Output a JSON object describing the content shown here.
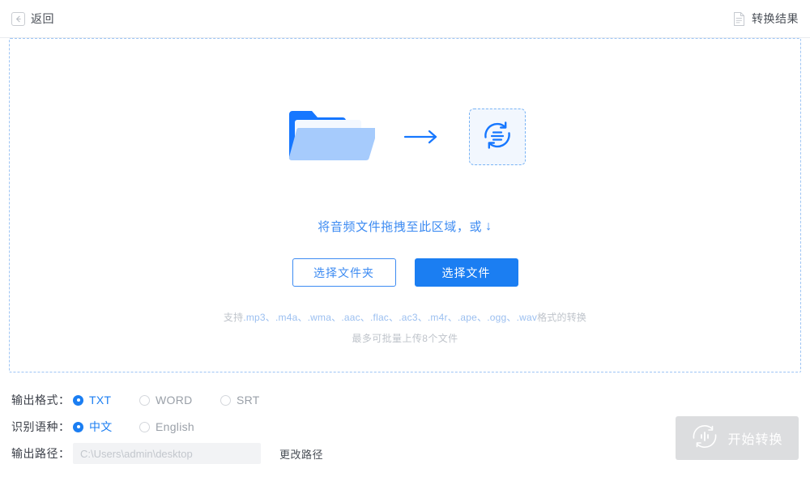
{
  "header": {
    "back_label": "返回",
    "back_icon": "arrow-left-icon",
    "result_label": "转换结果",
    "result_icon": "document-icon"
  },
  "dropzone": {
    "folder_icon": "folder-icon",
    "arrow_icon": "arrow-right-icon",
    "target_icon": "audio-convert-icon",
    "drag_text": "将音频文件拖拽至此区域，或",
    "drag_arrow": "↓",
    "select_folder_label": "选择文件夹",
    "select_file_label": "选择文件",
    "formats_prefix": "支持",
    "formats_text": ".mp3、.m4a、.wma、.aac、.flac、.ac3、.m4r、.ape、.ogg、.wav",
    "formats_suffix": "格式的转换",
    "limit_text": "最多可批量上传8个文件"
  },
  "settings": {
    "output_format_label": "输出格式：",
    "output_format_options": [
      {
        "label": "TXT",
        "checked": true
      },
      {
        "label": "WORD",
        "checked": false
      },
      {
        "label": "SRT",
        "checked": false
      }
    ],
    "language_label": "识别语种：",
    "language_options": [
      {
        "label": "中文",
        "checked": true
      },
      {
        "label": "English",
        "checked": false
      }
    ],
    "output_path_label": "输出路径：",
    "output_path_value": "",
    "output_path_placeholder": "C:\\Users\\admin\\desktop",
    "change_path_label": "更改路径"
  },
  "action": {
    "start_label": "开始转换",
    "start_icon": "audio-wave-circle-icon",
    "start_disabled": true
  },
  "colors": {
    "accent": "#1b7ef2",
    "accent_light": "#3d8bf2",
    "dashed_border": "#9ec5f5",
    "muted_text": "#bfc4cb",
    "disabled_bg": "#dcdddf"
  }
}
